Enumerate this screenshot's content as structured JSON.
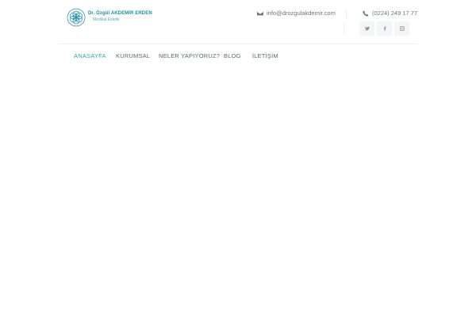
{
  "logo": {
    "name": "Dr. Özgül AKDEMİR ERDEN",
    "subtitle": "Medikal Estetik"
  },
  "contact": {
    "email": "info@drozgulakdemir.com",
    "phone": "(0224) 249 17 77"
  },
  "social": [
    {
      "icon": "twitter-icon"
    },
    {
      "icon": "facebook-icon"
    },
    {
      "icon": "instagram-icon"
    }
  ],
  "nav": {
    "items": [
      {
        "label": "ANASAYFA",
        "active": true
      },
      {
        "label": "KURUMSAL"
      },
      {
        "label": "NELER YAPIYORUZ?"
      },
      {
        "label": "BLOG"
      },
      {
        "label": "İLETİŞİM"
      }
    ]
  },
  "colors": {
    "brand": "#1c8fa0",
    "accent": "#37a3b5",
    "text": "#5f6870",
    "social_bg": "#f3f5f6"
  }
}
